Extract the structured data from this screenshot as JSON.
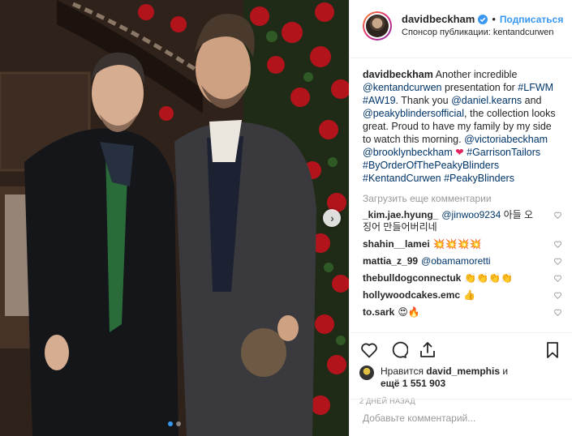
{
  "header": {
    "username": "davidbeckham",
    "separator": "•",
    "follow_label": "Подписаться",
    "sponsor_text": "Спонсор публикации: kentandcurwen",
    "verified_icon": "verified-badge-icon"
  },
  "caption": {
    "username": "davidbeckham",
    "t1": "Another incredible",
    "m1": "@kentandcurwen",
    "t2": "presentation for",
    "h1": "#LFWM",
    "h2": "#AW19",
    "t3": ". Thank you",
    "m2": "@daniel.kearns",
    "t4": "and",
    "m3": "@peakyblindersofficial",
    "t5": ", the collection looks great. Proud to have my family by my side to watch this morning.",
    "m4": "@victoriabeckham",
    "m5": "@brooklynbeckham",
    "heart": "❤",
    "h3": "#GarrisonTailors",
    "h4": "#ByOrderOfThePeakyBlinders",
    "h5": "#KentandCurwen",
    "h6": "#PeakyBlinders"
  },
  "load_more_label": "Загрузить еще комментарии",
  "comments": [
    {
      "user": "_kim.jae.hyung_",
      "mention": "@jinwoo9234",
      "text": "아들 오 징어 만들어버리네"
    },
    {
      "user": "shahin__lamei",
      "mention": "",
      "text": "💥💥💥💥"
    },
    {
      "user": "mattia_z_99",
      "mention": "@obamamoretti",
      "text": ""
    },
    {
      "user": "thebulldogconnectuk",
      "mention": "",
      "text": "👏👏👏👏"
    },
    {
      "user": "hollywoodcakes.emc",
      "mention": "",
      "text": "👍"
    },
    {
      "user": "to.sark",
      "mention": "",
      "text": "😍🔥"
    }
  ],
  "actions": {
    "like_icon": "heart-icon",
    "comment_icon": "comment-icon",
    "share_icon": "share-icon",
    "save_icon": "bookmark-icon"
  },
  "likes": {
    "prefix": "Нравится",
    "user": "david_memphis",
    "and_label": "и",
    "more": "ещё 1 551 903"
  },
  "time_ago": "2 ДНЕЙ НАЗАД",
  "comment_input": {
    "placeholder": "Добавьте комментарий..."
  },
  "carousel": {
    "slides": 2,
    "active_slide": 1
  },
  "colors": {
    "accent": "#3897f0",
    "link": "#003569",
    "muted": "#999999",
    "heart": "#e0245e"
  }
}
